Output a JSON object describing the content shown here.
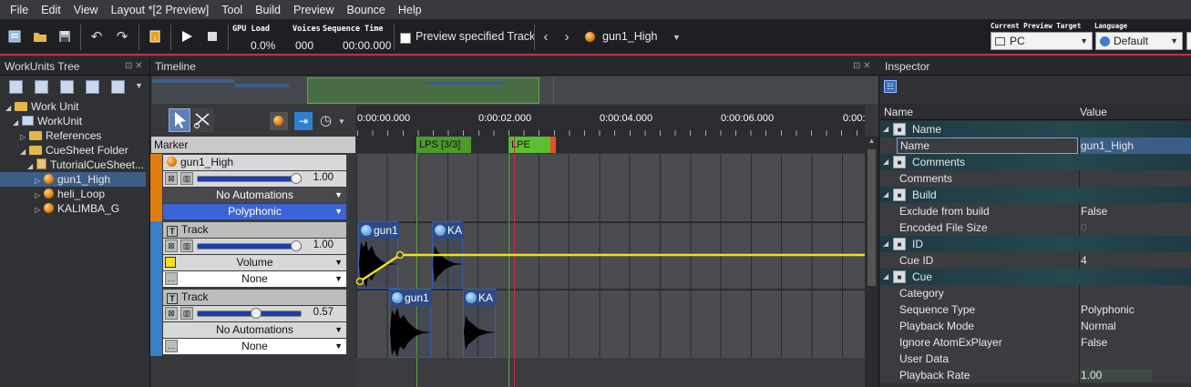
{
  "menu": [
    "File",
    "Edit",
    "View",
    "Layout *[2 Preview]",
    "Tool",
    "Build",
    "Preview",
    "Bounce",
    "Help"
  ],
  "toolbar": {
    "gpu_label": "GPU Load",
    "gpu_value": "0.0%",
    "voices_label": "Voices",
    "voices_value": "000",
    "seqtime_label": "Sequence Time",
    "seqtime_value": "00:00.000",
    "preview_track_label": "Preview specified Track",
    "current_cue": "gun1_High",
    "target_label": "Current Preview Target",
    "target_value": "PC",
    "language_label": "Language",
    "language_value": "Default"
  },
  "workunits": {
    "title": "WorkUnits Tree",
    "items": [
      {
        "label": "Work Unit"
      },
      {
        "label": "WorkUnit"
      },
      {
        "label": "References"
      },
      {
        "label": "CueSheet Folder"
      },
      {
        "label": "TutorialCueSheet..."
      },
      {
        "label": "gun1_High"
      },
      {
        "label": "heli_Loop"
      },
      {
        "label": "KALIMBA_G"
      }
    ]
  },
  "timeline": {
    "title": "Timeline",
    "marker_label": "Marker",
    "ticks": [
      "0:00:00.000",
      "0:00:02.000",
      "0:00:04.000",
      "0:00:06.000",
      "0:00:"
    ],
    "markers": {
      "lps": "LPS [3/3]",
      "lpe": "LPE"
    },
    "cue_row": {
      "name": "gun1_High",
      "volume": "1.00",
      "automation": "No Automations",
      "mode": "Polyphonic"
    },
    "track1": {
      "name": "Track",
      "volume": "1.00",
      "param": "Volume",
      "aux": "None"
    },
    "track2": {
      "name": "Track",
      "volume": "0.57",
      "automation": "No Automations",
      "aux": "None"
    },
    "waves": [
      {
        "label": "gun1"
      },
      {
        "label": "KA"
      },
      {
        "label": "gun1"
      },
      {
        "label": "KA"
      }
    ]
  },
  "inspector": {
    "title": "Inspector",
    "col_name": "Name",
    "col_value": "Value",
    "rows": [
      {
        "name": "Name",
        "value": "",
        "group": true
      },
      {
        "name": "Name",
        "value": "gun1_High"
      },
      {
        "name": "Comments",
        "value": "",
        "group": true
      },
      {
        "name": "Comments",
        "value": ""
      },
      {
        "name": "Build",
        "value": "",
        "group": true
      },
      {
        "name": "Exclude from build",
        "value": "False"
      },
      {
        "name": "Encoded File Size",
        "value": "0"
      },
      {
        "name": "ID",
        "value": "",
        "group": true
      },
      {
        "name": "Cue ID",
        "value": "4"
      },
      {
        "name": "Cue",
        "value": "",
        "group": true
      },
      {
        "name": "Category",
        "value": ""
      },
      {
        "name": "Sequence Type",
        "value": "Polyphonic"
      },
      {
        "name": "Playback Mode",
        "value": "Normal"
      },
      {
        "name": "Ignore AtomExPlayer",
        "value": "False"
      },
      {
        "name": "User Data",
        "value": ""
      },
      {
        "name": "Playback Rate",
        "value": "1.00"
      }
    ]
  },
  "colors": {
    "accent": "#c33242",
    "selection": "#3c5e86",
    "automation": "#f1e21b",
    "lps": "#5cae3c",
    "lpe": "#5cae3c"
  }
}
